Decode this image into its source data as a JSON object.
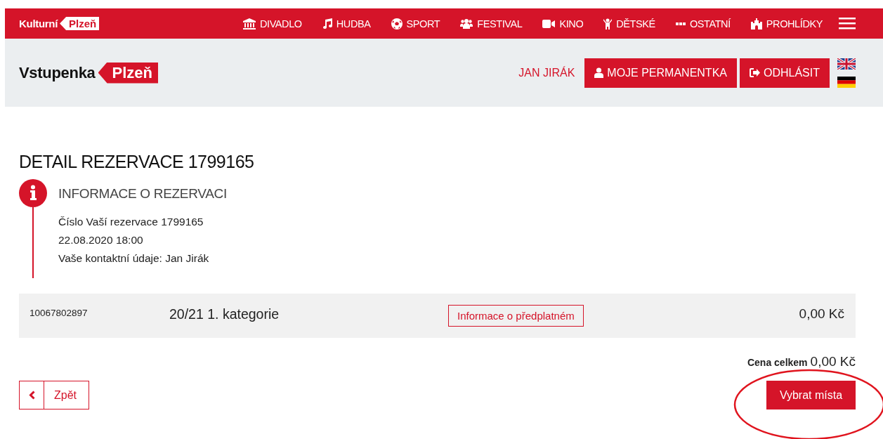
{
  "top_bar": {
    "logo": {
      "text": "Kulturní",
      "tag": "Plzeň"
    },
    "nav": [
      {
        "label": "DIVADLO"
      },
      {
        "label": "HUDBA"
      },
      {
        "label": "SPORT"
      },
      {
        "label": "FESTIVAL"
      },
      {
        "label": "KINO"
      },
      {
        "label": "DĚTSKÉ"
      },
      {
        "label": "OSTATNÍ"
      },
      {
        "label": "PROHLÍDKY"
      }
    ]
  },
  "header": {
    "logo": {
      "text": "Vstupenka",
      "tag": "Plzeň"
    },
    "user": "JAN JIRÁK",
    "buttons": [
      {
        "label": "MOJE PERMANENTKA",
        "kind": "user"
      },
      {
        "label": "ODHLÁSIT",
        "kind": "logout"
      }
    ],
    "languages": [
      {
        "kind": "en"
      },
      {
        "kind": "de"
      }
    ]
  },
  "title": "DETAIL REZERVACE 1799165",
  "info": {
    "heading": "INFORMACE O REZERVACI",
    "lines": [
      "Číslo Vaší rezervace 1799165",
      "22.08.2020 18:00",
      "Vaše kontaktní údaje: Jan Jirák"
    ]
  },
  "items": [
    {
      "code": "10067802897",
      "name": "20/21 1. kategorie",
      "link": "Informace o předplatném",
      "price": "0,00 Kč"
    }
  ],
  "total": {
    "label": "Cena celkem",
    "value": "0,00 Kč"
  },
  "back_button": "Zpět",
  "action_button": "Vybrat místa",
  "annotations": [
    {
      "kind": "ellipse"
    }
  ]
}
